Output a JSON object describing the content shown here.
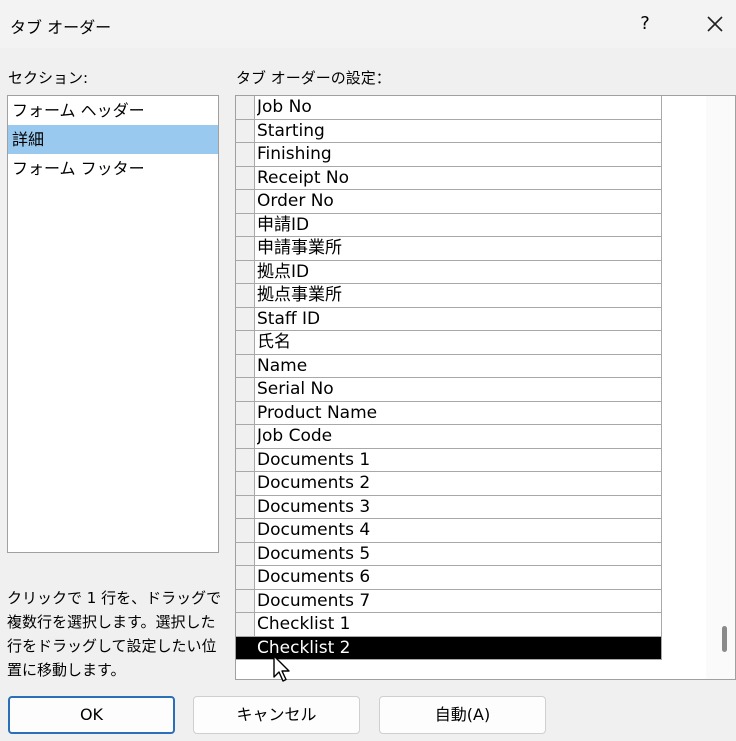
{
  "window": {
    "title": "タブ オーダー",
    "help_label": "?"
  },
  "sections": {
    "label": "セクション:",
    "items": [
      "フォーム ヘッダー",
      "詳細",
      "フォーム フッター"
    ],
    "selected_index": 1
  },
  "tab_order": {
    "label": "タブ オーダーの設定：",
    "fields": [
      "Job No",
      "Starting",
      "Finishing",
      "Receipt No",
      "Order No",
      "申請ID",
      "申請事業所",
      "拠点ID",
      "拠点事業所",
      "Staff ID",
      "氏名",
      "Name",
      "Serial No",
      "Product Name",
      "Job Code",
      "Documents 1",
      "Documents 2",
      "Documents 3",
      "Documents 4",
      "Documents 5",
      "Documents 6",
      "Documents 7",
      "Checklist 1",
      "Checklist 2"
    ],
    "selected_index": 23
  },
  "help_text": "クリックで 1 行を、ドラッグで複数行を選択します。選択した行をドラッグして設定したい位置に移動します。",
  "buttons": {
    "ok": "OK",
    "cancel": "キャンセル",
    "auto": "自動(A)"
  },
  "icons": {
    "close": "close-icon",
    "cursor": "mouse-pointer-icon"
  },
  "colors": {
    "selection_blue": "#99c9ef",
    "selected_row": "#000000",
    "ok_border": "#2a6fb8"
  }
}
